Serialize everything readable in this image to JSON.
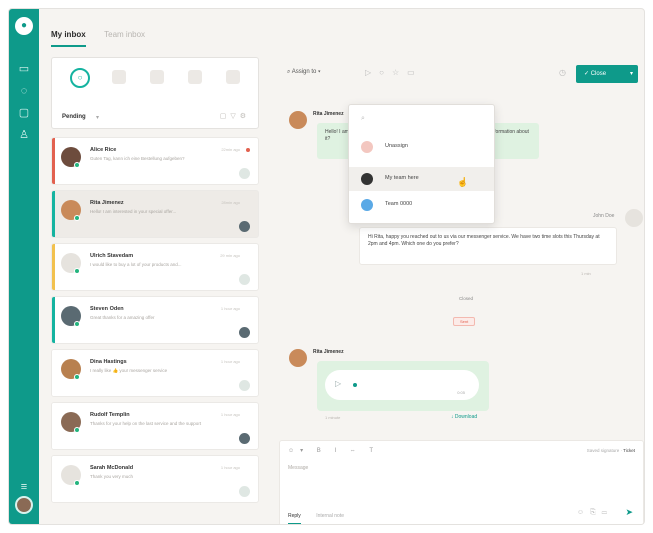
{
  "app": {
    "brand_color": "#0e9a8a",
    "accent_color": "#15b3a0"
  },
  "sidebar": {
    "icons": [
      "inbox-icon",
      "chat-icon",
      "contacts-icon",
      "user-icon"
    ],
    "bottom_icons": [
      "menu-icon"
    ]
  },
  "tabs": [
    {
      "label": "My inbox",
      "active": true
    },
    {
      "label": "Team inbox",
      "active": false
    }
  ],
  "filters": {
    "status": "Pending",
    "status_caret": "▾",
    "tool_icons": [
      "chat-icon",
      "filter-icon",
      "settings-icon"
    ],
    "active_filter": "○"
  },
  "conversations": [
    {
      "name": "Alice Rice",
      "message": "Guten Tag, kann ich eine Bestellung aufgeben?",
      "time": "22min ago",
      "bar": "#e2614f",
      "unread": true,
      "avatar": "#6d4c3d"
    },
    {
      "name": "Rita Jimenez",
      "message": "Hello! I am interested in your special offer...",
      "time": "28min ago",
      "bar": "#15b3a0",
      "selected": true,
      "avatar": "#c98a5a"
    },
    {
      "name": "Ulrich Stavedam",
      "message": "I would like to buy a lot of your products and...",
      "time": "29 min ago",
      "bar": "#f2c14e",
      "avatar": "#e6e3de"
    },
    {
      "name": "Steven Oden",
      "message": "Great thanks for a amazing offer",
      "time": "1 hour ago",
      "bar": "#15b3a0",
      "avatar": "#5a6a72"
    },
    {
      "name": "Dina Hastings",
      "message": "I really like 👍 your messenger service",
      "time": "1 hour ago",
      "bar": "#ffffff",
      "avatar": "#b8804f"
    },
    {
      "name": "Rudolf Templin",
      "message": "Thanks for your help on the last service and the support",
      "time": "1 hour ago",
      "bar": "#ffffff",
      "avatar": "#8a6a55"
    },
    {
      "name": "Sarah McDonald",
      "message": "Thank you very much",
      "time": "1 hour ago",
      "bar": "#ffffff",
      "avatar": "#e6e3de"
    }
  ],
  "toolbar": {
    "assign_label": "Assign to",
    "close_label": "Close"
  },
  "assign_dropdown": {
    "items": [
      {
        "label": "Unassign",
        "icon_color": "#f3c7c0"
      },
      {
        "label": "My team here",
        "icon_color": "#333333",
        "hover": true
      },
      {
        "label": "Team 0000",
        "icon_color": "#5aa9e6"
      }
    ]
  },
  "chat": {
    "first_author": "Rita Jimenez",
    "first_message": "Hello! I am interested in your special offer. Could you send me some more information about it?",
    "agent_name": "John Doe",
    "agent_message": "Hi Rita, happy you reached out to us via our messenger service. We have two time slots this Thursday at 2pm and 4pm. Which one do you prefer?",
    "agent_meta": "1 min",
    "separator": "Closed",
    "pill": "Sent",
    "second_author": "Rita Jimenez",
    "audio_duration": "0:05",
    "download_label": "↓ Download",
    "audio_meta": "1 minute"
  },
  "composer": {
    "placeholder": "Message",
    "right_hint": "Saved signature",
    "right_label": "Ticket",
    "tabs": [
      "Reply",
      "Internal note"
    ]
  }
}
